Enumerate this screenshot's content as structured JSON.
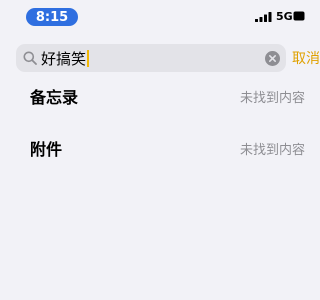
{
  "status_bar": {
    "time": "8:15",
    "network": "5G",
    "time_pill_color": "#2f6fe0"
  },
  "search": {
    "query": "好搞笑",
    "cancel_label": "取消",
    "cursor_color": "#f2b705",
    "icons": {
      "search": "search-icon",
      "clear": "clear-icon"
    }
  },
  "results": {
    "notes": {
      "title": "备忘录",
      "status": "未找到内容"
    },
    "attachments": {
      "title": "附件",
      "status": "未找到内容"
    }
  },
  "colors": {
    "background": "#f2f2f7",
    "accent": "#e0a100",
    "secondary_text": "#8e8e93"
  }
}
